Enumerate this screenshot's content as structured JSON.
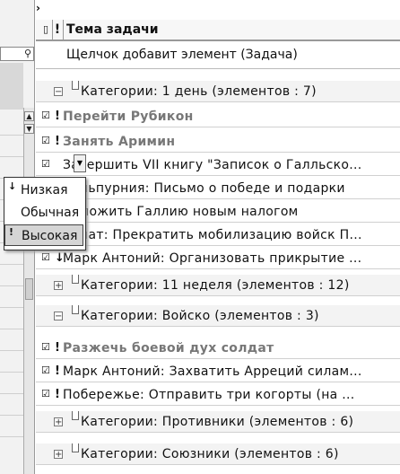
{
  "left_pane": {
    "search_icon": "magnifier-icon"
  },
  "header": {
    "chevron": "›",
    "doc_col": "▯",
    "importance_col": "!",
    "subject_col": "Тема задачи"
  },
  "new_item": {
    "placeholder": "Щелчок добавит элемент (Задача)"
  },
  "rows": [
    {
      "kind": "group",
      "expand": "−",
      "label": "Категории: 1 день (элементов : 7)"
    },
    {
      "kind": "task",
      "icon": "task-icon",
      "importance": "!",
      "label": "Перейти Рубикон",
      "done": true
    },
    {
      "kind": "task",
      "icon": "task-icon",
      "importance": "!",
      "label": "Занять Аримин",
      "done": true
    },
    {
      "kind": "task",
      "icon": "task-icon",
      "importance": "",
      "label": "Завершить VII книгу \"Записок о Галльско...",
      "done": false
    },
    {
      "kind": "task",
      "icon": "task-icon",
      "importance": "",
      "label": "Кальпурния: Письмо о победе и подарки",
      "done": false
    },
    {
      "kind": "task",
      "icon": "task-icon",
      "importance": "",
      "label": "Обложить Галлию новым налогом",
      "done": false
    },
    {
      "kind": "task",
      "icon": "task-icon",
      "importance": "",
      "label": "Сенат: Прекратить мобилизацию войск П...",
      "done": false
    },
    {
      "kind": "task",
      "icon": "task-icon",
      "importance": "↓",
      "label": "Марк Антоний: Организовать прикрытие ...",
      "done": false
    },
    {
      "kind": "group",
      "expand": "+",
      "label": "Категории: 11 неделя (элементов : 12)"
    },
    {
      "kind": "group",
      "expand": "−",
      "label": "Категории: Войско (элементов : 3)"
    },
    {
      "kind": "task",
      "icon": "task-icon",
      "importance": "!",
      "label": "Разжечь боевой дух солдат",
      "done": true
    },
    {
      "kind": "task",
      "icon": "task-icon",
      "importance": "!",
      "label": "Марк Антоний: Захватить Арреций силам...",
      "done": false
    },
    {
      "kind": "task",
      "icon": "task-icon",
      "importance": "!",
      "label": "Побережье: Отправить три когорты (на ...",
      "done": false
    },
    {
      "kind": "group",
      "expand": "+",
      "label": "Категории: Противники (элементов : 6)"
    },
    {
      "kind": "group",
      "expand": "+",
      "label": "Категории: Союзники (элементов : 6)"
    }
  ],
  "importance_dropdown": {
    "items": [
      {
        "icon": "↓",
        "label": "Низкая"
      },
      {
        "icon": "",
        "label": "Обычная"
      },
      {
        "icon": "!",
        "label": "Высокая"
      }
    ],
    "selected": "Высокая"
  }
}
